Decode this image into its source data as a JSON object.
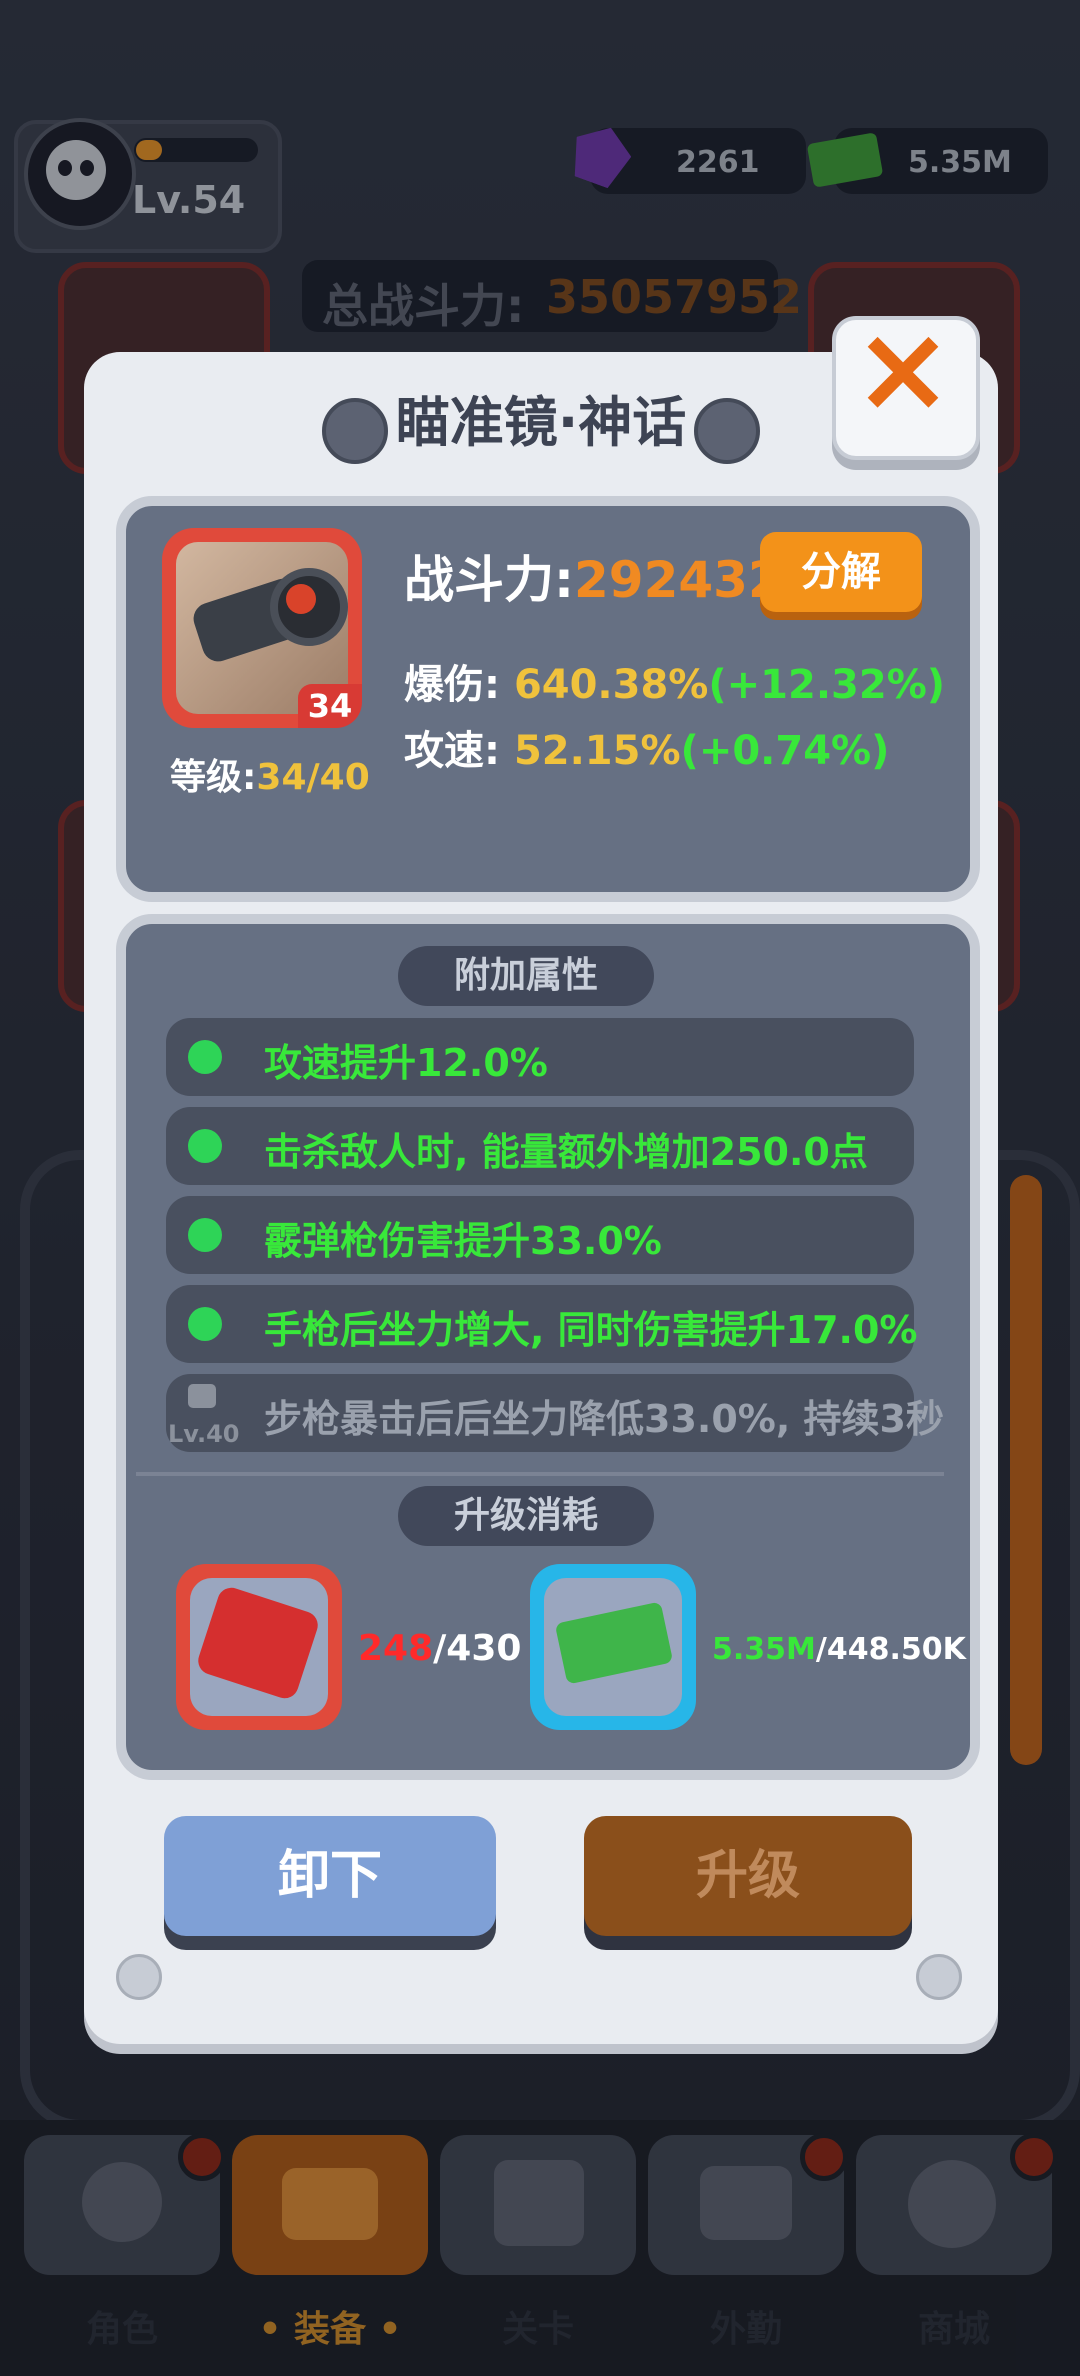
{
  "header": {
    "player_level": "Lv.54",
    "level_progress": 0.22,
    "gems": "2261",
    "cash": "5.35M",
    "total_power_label": "总战斗力:",
    "total_power_value": "35057952"
  },
  "modal": {
    "title": "瞄准镜·神话",
    "item": {
      "level_badge": "34",
      "level_label": "等级:",
      "level_value": "34/40",
      "power_label": "战斗力:",
      "power_value": "2924328",
      "decompose_label": "分解",
      "stats": [
        {
          "label": "爆伤:",
          "value": "640.38%",
          "bonus": "(+12.32%)"
        },
        {
          "label": "攻速:",
          "value": "52.15%",
          "bonus": "(+0.74%)"
        }
      ]
    },
    "extra_attributes": {
      "title": "附加属性",
      "items": [
        {
          "text": "攻速提升12.0%",
          "locked": false
        },
        {
          "text": "击杀敌人时, 能量额外增加250.0点",
          "locked": false
        },
        {
          "text": "霰弹枪伤害提升33.0%",
          "locked": false
        },
        {
          "text": "手枪后坐力增大, 同时伤害提升17.0%",
          "locked": false
        },
        {
          "text": "步枪暴击后后坐力降低33.0%, 持续3秒",
          "locked": true,
          "lock_level": "Lv.40"
        }
      ]
    },
    "upgrade_cost": {
      "title": "升级消耗",
      "material_have": "248",
      "material_need": "/430",
      "cash_have": "5.35M",
      "cash_need": "/448.50K"
    },
    "unequip_label": "卸下",
    "upgrade_label": "升级"
  },
  "nav": {
    "tabs": [
      {
        "label": "角色",
        "active": false
      },
      {
        "label": "• 装备 •",
        "active": true
      },
      {
        "label": "关卡",
        "active": false
      },
      {
        "label": "外勤",
        "active": false
      },
      {
        "label": "商城",
        "active": false
      }
    ]
  },
  "colors": {
    "accent_orange": "#f39219",
    "power_orange": "#f08a22",
    "stat_yellow": "#f0c23c",
    "bonus_green": "#38e83a",
    "rarity_red": "#e04a3b",
    "rarity_blue": "#27b6e8"
  },
  "icons": [
    "skull-avatar-icon",
    "purple-gem-icon",
    "cash-stack-icon",
    "close-icon",
    "scope-icon",
    "gear-chip-icon",
    "money-stack-icon",
    "lock-icon"
  ]
}
